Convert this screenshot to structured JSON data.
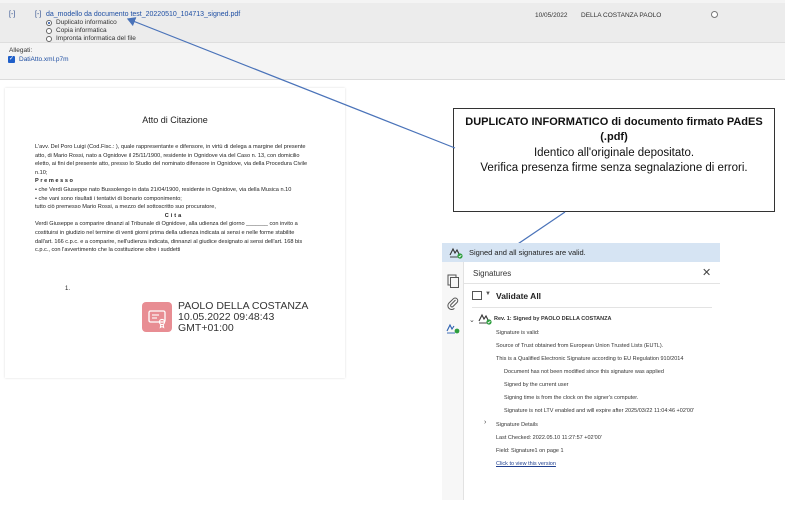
{
  "attachment": {
    "toggle_outer": "[-]",
    "toggle_inner": "[-]",
    "file_name": "da_modello da documento test_20220510_104713_signed.pdf",
    "options": [
      {
        "label": "Duplicato informatico",
        "selected": true
      },
      {
        "label": "Copia informatica",
        "selected": false
      },
      {
        "label": "Impronta informatica del file",
        "selected": false
      }
    ],
    "date": "10/05/2022",
    "signer": "DELLA COSTANZA PAOLO",
    "attachments_label": "Allegati:",
    "attached_file": "DatiAtto.xml.p7m"
  },
  "document": {
    "heading": "Atto di Citazione",
    "p1": "L'avv. Del Poro Luigi (Cod.Fisc.: ), quale rappresentante e difensore, in virtù di delega a margine del presente atto, di Mario Rossi, nato a Ognidove il 25/11/1900, residente in Ognidove via del Caso n. 13, con domicilio eletto, ai fini del presente atto, presso lo Studio del nominato difensore in Ognidove, via della Procedura Civile n.10;",
    "section_premesso": "Premesso",
    "bullet1": "che Verdi Giuseppe nato Bussolengo in data 21/04/1900, residente in Ognidove, via della Musica n.10",
    "bullet2": "che vani sono risultati i tentativi di bonario componimento;",
    "line_tutto": "tutto ciò premesso Mario Rossi, a mezzo del sottoscritto suo procuratore,",
    "section_cita": "Cita",
    "p2": "Verdi Giuseppe a comparire dinanzi al Tribunale di Ognidove, alla udienza del giorno _______ con invito a costituirsi in giudizio nel termine di venti giorni prima della udienza indicata ai sensi e nelle forme stabilite dall'art. 166 c.p.c. e a comparire, nell'udienza indicata, dinnanzi al giudice designato ai sensi dell'art. 168 bis c.p.c., con l'avvertimento che la costituzione oltre i suddetti",
    "item_num": "1.",
    "stamp": {
      "name": "PAOLO DELLA COSTANZA",
      "date": "10.05.2022 09:48:43",
      "tz": "GMT+01:00",
      "color": "#e88d93"
    }
  },
  "callout": {
    "title": "DUPLICATO INFORMATICO di documento firmato PAdES (.pdf)",
    "line1": "Identico all'originale depositato.",
    "line2": "Verifica presenza firme senza segnalazione di errori."
  },
  "signatures": {
    "banner": "Signed and all signatures are valid.",
    "panel_title": "Signatures",
    "close": "✕",
    "validate_all": "Validate All",
    "rev_title": "Rev. 1: Signed by PAOLO DELLA COSTANZA",
    "lines": [
      "Signature is valid:",
      "Source of Trust obtained from European Union Trusted Lists (EUTL).",
      "This is a Qualified Electronic Signature according to EU Regulation 910/2014",
      "Document has not been modified since this signature was applied",
      "Signed by the current user",
      "Signing time is from the clock on the signer's computer.",
      "Signature is not LTV enabled and will expire after 2025/03/22 11:04:46 +02'00'"
    ],
    "details": "Signature Details",
    "last_checked": "Last Checked: 2022.05.10 11:27:57 +02'00'",
    "field": "Field: Signature1 on page 1",
    "view_version": "Click to view this version",
    "banner_color": "#d6e4f3",
    "valid_color": "#2e9e3f"
  }
}
